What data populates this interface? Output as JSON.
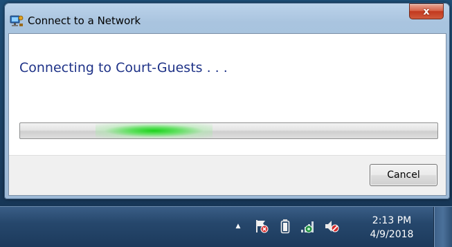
{
  "window": {
    "title": "Connect to a Network",
    "close_label": "x",
    "status_text": "Connecting to Court-Guests . . .",
    "cancel_label": "Cancel"
  },
  "progress": {
    "type": "marquee-indeterminate",
    "glow_position_fraction": 0.32,
    "color": "#1bd31b"
  },
  "taskbar": {
    "tray_icons": [
      "show-hidden-icons-arrow",
      "action-center-flag-error-icon",
      "battery-icon",
      "network-connecting-icon",
      "volume-muted-icon"
    ],
    "clock": {
      "time": "2:13 PM",
      "date": "4/9/2018"
    }
  },
  "colors": {
    "heading_blue": "#1e3287",
    "close_red": "#c2391f",
    "taskbar_blue": "#26476c"
  }
}
